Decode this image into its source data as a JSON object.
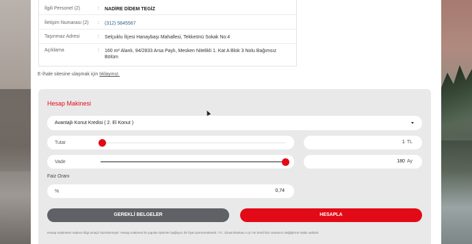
{
  "info": {
    "rows": [
      {
        "key": "İlgili Personel (2)",
        "sep": ":",
        "value": "NADİRE DİDEM TEGİZ"
      },
      {
        "key": "İletişim Numarası (2)",
        "sep": ":",
        "value": "(312) 5845567"
      },
      {
        "key": "Taşınmaz Adresi",
        "sep": ":",
        "value": "Selçuklu İlçesi Hanaybaşı Mahallesi, Tekkeönü Sokak No:4"
      },
      {
        "key": "Açıklama",
        "sep": ":",
        "value": "160 m² Alanlı, 94/2833 Arsa Paylı, Mesken Nitelikli 1. Kat A Blok 3 Nolu Bağımsız Bölüm"
      }
    ]
  },
  "eihale": {
    "text": "E-İhale sitesine ulaşmak için ",
    "link": "tıklayınız."
  },
  "calculator": {
    "title": "Hesap Makinesi",
    "loan_type": "Avantajlı Konut Kredisi ( 2. El Konut )",
    "tutar": {
      "label": "Tutar",
      "value": "1",
      "unit": "TL",
      "slider_fraction": 0.0
    },
    "vade": {
      "label": "Vade",
      "value": "180",
      "unit": "Ay",
      "slider_fraction": 1.0
    },
    "faiz": {
      "label": "Faiz Oranı",
      "prefix": "%",
      "value": "0,74"
    },
    "buttons": {
      "documents": "GEREKLİ BELGELER",
      "calculate": "HESAPLA"
    },
    "disclaimer": "Hesap makineleri sadece bilgi amaçlı hazırlanmıştır. Hesap makinesi ile yapılan işlemler bağlayıcı bir fiyat içermemektedir. T.C. Ziraat Bankası A.Ş.'nin kredi faiz oranlarını değiştirme hakkı saklıdır."
  },
  "colors": {
    "accent": "#e30a17",
    "dark_button": "#5e6266",
    "panel": "#e9e9ea"
  }
}
